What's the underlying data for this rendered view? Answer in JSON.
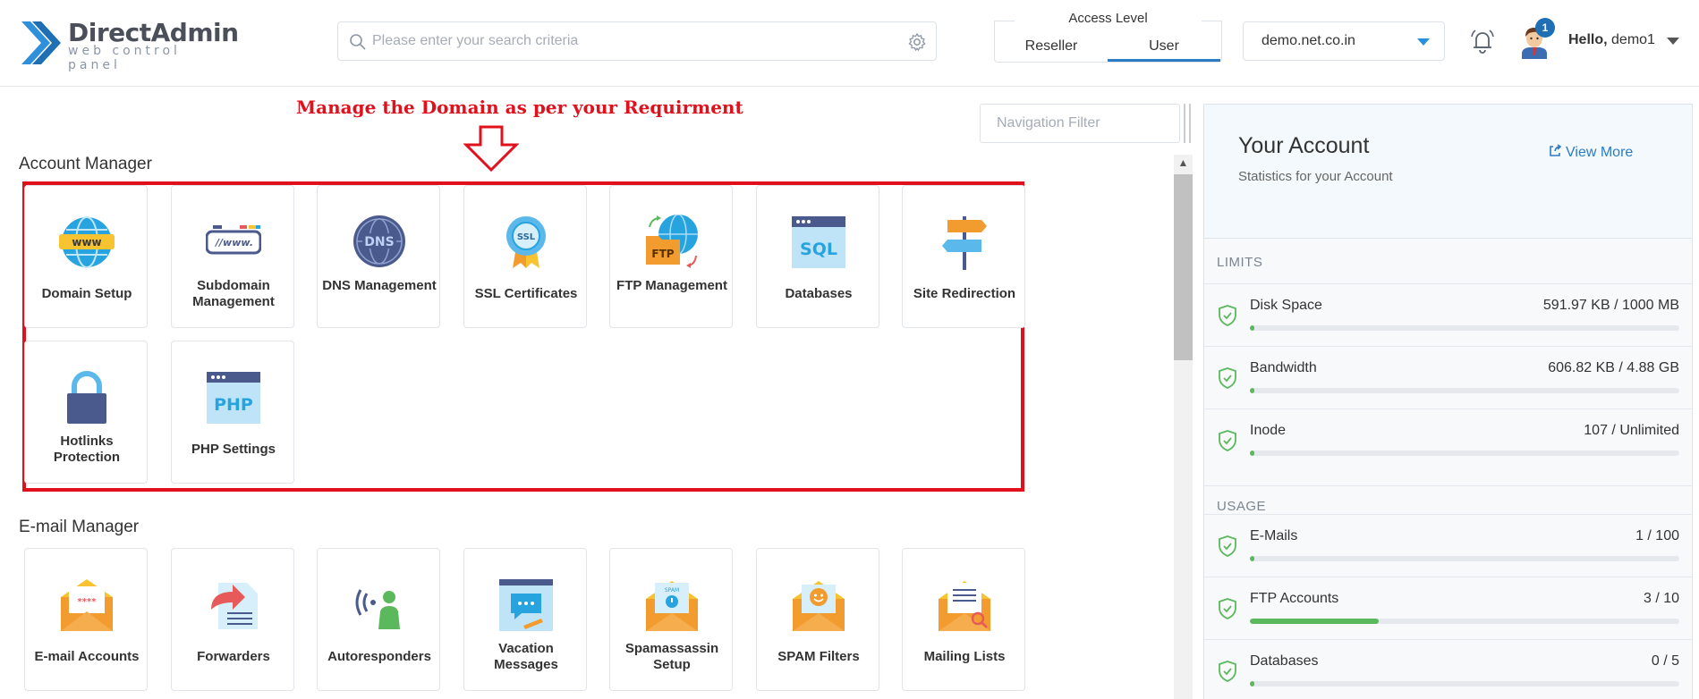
{
  "header": {
    "logo_name": "DirectAdmin",
    "logo_tagline": "web control panel",
    "search_placeholder": "Please enter your search criteria",
    "access_level": {
      "title": "Access Level",
      "options": [
        "Reseller",
        "User"
      ],
      "selected": "User"
    },
    "domain": "demo.net.co.in",
    "notifications_count": "1",
    "greeting_prefix": "Hello,",
    "username": "demo1"
  },
  "annotation": {
    "text": "Manage the Domain as per your Requirment"
  },
  "nav_filter_placeholder": "Navigation Filter",
  "account_manager": {
    "title": "Account Manager",
    "tiles": [
      {
        "label": "Domain Setup",
        "icon": "www-globe-icon"
      },
      {
        "label": "Subdomain Management",
        "icon": "subdomain-icon"
      },
      {
        "label": "DNS Management",
        "icon": "dns-globe-icon"
      },
      {
        "label": "SSL Certificates",
        "icon": "ssl-badge-icon"
      },
      {
        "label": "FTP Management",
        "icon": "ftp-folder-icon"
      },
      {
        "label": "Databases",
        "icon": "sql-database-icon"
      },
      {
        "label": "Site Redirection",
        "icon": "signpost-icon"
      },
      {
        "label": "Hotlinks Protection",
        "icon": "padlock-icon"
      },
      {
        "label": "PHP Settings",
        "icon": "php-window-icon"
      }
    ]
  },
  "email_manager": {
    "title": "E-mail Manager",
    "tiles": [
      {
        "label": "E-mail Accounts",
        "icon": "email-envelope-icon"
      },
      {
        "label": "Forwarders",
        "icon": "forward-arrow-icon"
      },
      {
        "label": "Autoresponders",
        "icon": "autoresponder-icon"
      },
      {
        "label": "Vacation Messages",
        "icon": "chat-bubble-icon"
      },
      {
        "label": "Spamassassin Setup",
        "icon": "spam-envelope-icon"
      },
      {
        "label": "SPAM Filters",
        "icon": "smiley-envelope-icon"
      },
      {
        "label": "Mailing Lists",
        "icon": "mailing-list-icon"
      }
    ]
  },
  "account_panel": {
    "title": "Your Account",
    "subtitle": "Statistics for your Account",
    "view_more": "View More",
    "limits_label": "LIMITS",
    "usage_label": "USAGE",
    "limits": [
      {
        "name": "Disk Space",
        "value": "591.97 KB / 1000 MB",
        "percent": 0.1
      },
      {
        "name": "Bandwidth",
        "value": "606.82 KB / 4.88 GB",
        "percent": 0.1
      },
      {
        "name": "Inode",
        "value": "107 / Unlimited",
        "percent": 0.1
      }
    ],
    "usage": [
      {
        "name": "E-Mails",
        "value": "1 / 100",
        "percent": 1
      },
      {
        "name": "FTP Accounts",
        "value": "3 / 10",
        "percent": 30
      },
      {
        "name": "Databases",
        "value": "0 / 5",
        "percent": 0
      }
    ]
  },
  "colors": {
    "accent_blue": "#2a7cc7",
    "annotation_red": "#e0101c",
    "progress_green": "#5cb85c"
  }
}
